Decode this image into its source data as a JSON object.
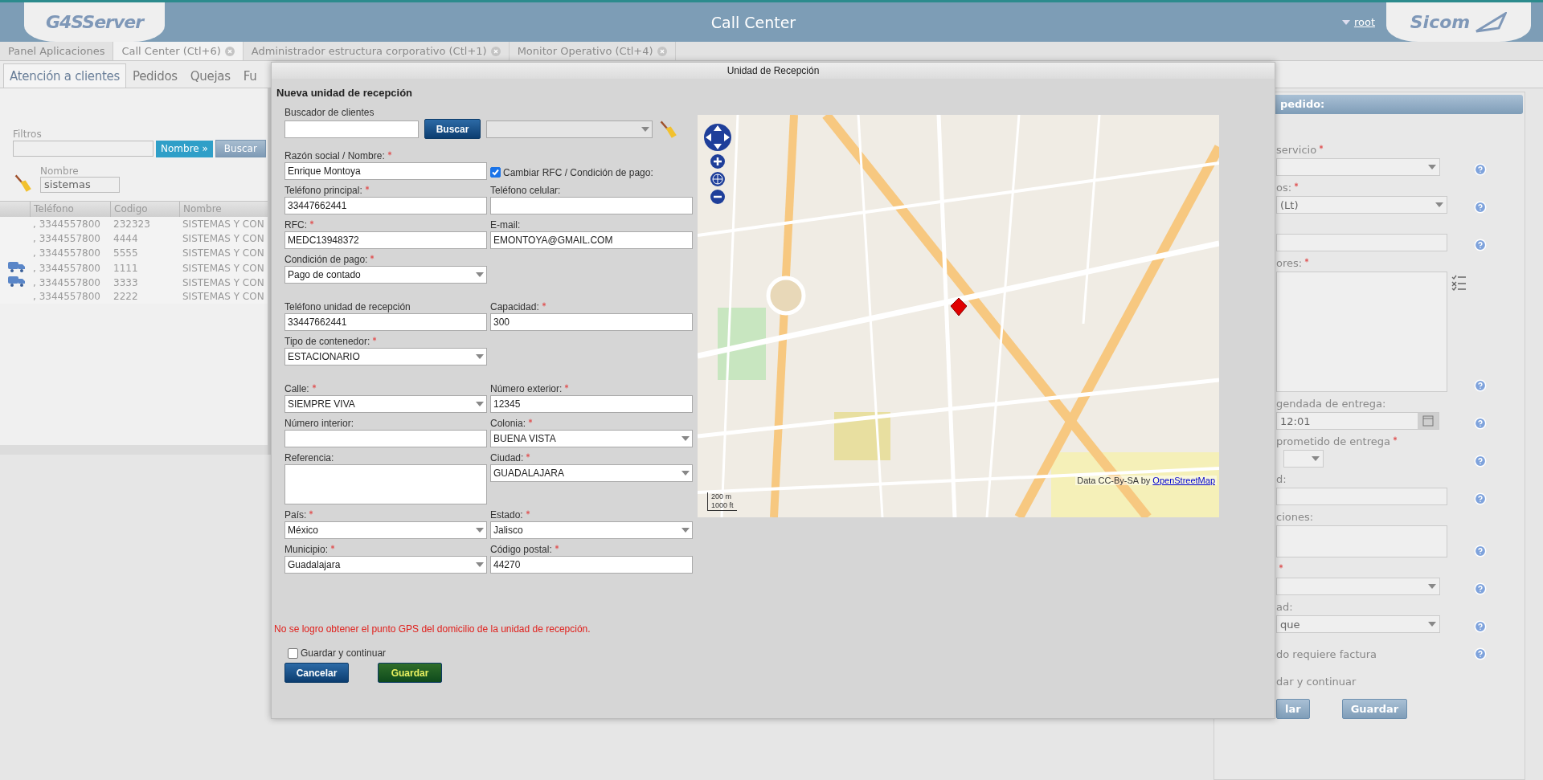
{
  "header": {
    "logo_left": "G4SServer",
    "title": "Call Center",
    "user": "root",
    "logo_right": "Sicom"
  },
  "app_tabs": [
    {
      "label": "Panel Aplicaciones",
      "selected": false,
      "closable": false
    },
    {
      "label": "Call Center (Ctl+6)",
      "selected": true,
      "closable": true
    },
    {
      "label": "Administrador estructura corporativo (Ctl+1)",
      "selected": false,
      "closable": true
    },
    {
      "label": "Monitor Operativo (Ctl+4)",
      "selected": false,
      "closable": true
    }
  ],
  "sub_tabs": [
    {
      "label": "Atención a clientes",
      "selected": true
    },
    {
      "label": "Pedidos",
      "selected": false
    },
    {
      "label": "Quejas",
      "selected": false
    },
    {
      "label": "Fu",
      "selected": false
    }
  ],
  "filters": {
    "label": "Filtros",
    "chip": "Nombre »",
    "button": "Buscar",
    "name_label": "Nombre",
    "name_value": "sistemas"
  },
  "table": {
    "columns": [
      "Teléfono",
      "Codigo",
      "Nombre"
    ],
    "rows": [
      {
        "truck": false,
        "cells": [
          ", 3344557800",
          "232323",
          "SISTEMAS Y CON"
        ]
      },
      {
        "truck": false,
        "cells": [
          ", 3344557800",
          "4444",
          "SISTEMAS Y CON"
        ]
      },
      {
        "truck": false,
        "cells": [
          ", 3344557800",
          "5555",
          "SISTEMAS Y CON"
        ]
      },
      {
        "truck": true,
        "cells": [
          ", 3344557800",
          "1111",
          "SISTEMAS Y CON"
        ]
      },
      {
        "truck": true,
        "cells": [
          ", 3344557800",
          "3333",
          "SISTEMAS Y CON"
        ]
      },
      {
        "truck": false,
        "cells": [
          ", 3344557800",
          "2222",
          "SISTEMAS Y CON"
        ]
      }
    ]
  },
  "order_panel": {
    "title": "pedido:",
    "rows": [
      {
        "kind": "label",
        "text": "servicio",
        "required": true
      },
      {
        "kind": "select",
        "help": true
      },
      {
        "kind": "label",
        "text": "os:",
        "required": true
      },
      {
        "kind": "select",
        "value": "(Lt)",
        "help": true,
        "wide": true
      },
      {
        "kind": "spacer"
      },
      {
        "kind": "input",
        "help": true
      },
      {
        "kind": "label",
        "text": "ores:",
        "required": true
      },
      {
        "kind": "textarea",
        "help": true
      },
      {
        "kind": "label",
        "text": "gendada de entrega:",
        "required": false
      },
      {
        "kind": "datetime",
        "value": "12:01",
        "help": true
      },
      {
        "kind": "label",
        "text": "prometido de entrega",
        "required": true
      },
      {
        "kind": "time",
        "help": true
      },
      {
        "kind": "label",
        "text": "d:",
        "required": false
      },
      {
        "kind": "input",
        "help": true
      },
      {
        "kind": "label",
        "text": "ciones:",
        "required": false
      },
      {
        "kind": "note",
        "help": true
      },
      {
        "kind": "label",
        "required": true
      },
      {
        "kind": "select",
        "help": true
      },
      {
        "kind": "label",
        "text": "ad:",
        "required": false
      },
      {
        "kind": "select",
        "value": "que",
        "help": true
      },
      {
        "kind": "check",
        "text": "do requiere factura",
        "help": true
      },
      {
        "kind": "check",
        "text": "dar y continuar",
        "help": false
      },
      {
        "kind": "buttons",
        "buttons": [
          "lar",
          "Guardar"
        ]
      }
    ]
  },
  "dialog": {
    "title": "Unidad de Recepción",
    "heading": "Nueva unidad de recepción",
    "client_search": {
      "label": "Buscador de clientes",
      "button": "Buscar"
    },
    "sections": [
      [
        [
          {
            "kind": "input",
            "label": "Razón social / Nombre:",
            "required": true,
            "value": "Enrique Montoya"
          },
          {
            "kind": "checkbox",
            "label": "Cambiar RFC / Condición de pago:",
            "checked": true
          }
        ],
        [
          {
            "kind": "input",
            "label": "Teléfono principal:",
            "required": true,
            "value": "33447662441"
          },
          {
            "kind": "input",
            "label": "Teléfono celular:",
            "required": false
          }
        ],
        [
          {
            "kind": "input",
            "label": "RFC:",
            "required": true,
            "value": "MEDC13948372"
          },
          {
            "kind": "input",
            "label": "E-mail:",
            "required": false,
            "value": "EMONTOYA@GMAIL.COM"
          }
        ],
        [
          {
            "kind": "select",
            "label": "Condición de pago:",
            "required": true,
            "value": "Pago de contado"
          }
        ]
      ],
      [
        [
          {
            "kind": "input",
            "label": "Teléfono unidad de recepción",
            "required": false,
            "value": "33447662441"
          },
          {
            "kind": "input",
            "label": "Capacidad:",
            "required": true,
            "value": "300"
          }
        ],
        [
          {
            "kind": "select",
            "label": "Tipo de contenedor:",
            "required": true,
            "value": "ESTACIONARIO"
          }
        ]
      ],
      [
        [
          {
            "kind": "select",
            "label": "Calle:",
            "required": true,
            "value": "SIEMPRE VIVA"
          },
          {
            "kind": "input",
            "label": "Número exterior:",
            "required": true,
            "value": "12345"
          }
        ],
        [
          {
            "kind": "input",
            "label": "Número interior:",
            "required": false
          },
          {
            "kind": "select",
            "label": "Colonia:",
            "required": true,
            "value": "BUENA VISTA"
          }
        ],
        [
          {
            "kind": "textarea",
            "label": "Referencia:",
            "required": false
          },
          {
            "kind": "select",
            "label": "Ciudad:",
            "required": true,
            "value": "GUADALAJARA"
          }
        ],
        [
          {
            "kind": "select",
            "label": "País:",
            "required": true,
            "value": "México"
          },
          {
            "kind": "select",
            "label": "Estado:",
            "required": true,
            "value": "Jalisco"
          }
        ],
        [
          {
            "kind": "select",
            "label": "Municipio:",
            "required": true,
            "value": "Guadalajara"
          },
          {
            "kind": "input",
            "label": "Código postal:",
            "required": true,
            "value": "44270"
          }
        ]
      ]
    ],
    "error": "No se logro obtener el punto GPS del domicilio de la unidad de recepción.",
    "save_and_continue": {
      "label": "Guardar y continuar",
      "checked": false
    },
    "buttons": [
      {
        "label": "Cancelar",
        "highlighted": false
      },
      {
        "label": "Guardar",
        "highlighted": true
      }
    ],
    "map": {
      "attribution": "Data CC-By-SA by",
      "attribution_link": "OpenStreetMap",
      "scale_m": "200 m",
      "scale_ft": "1000 ft"
    }
  }
}
